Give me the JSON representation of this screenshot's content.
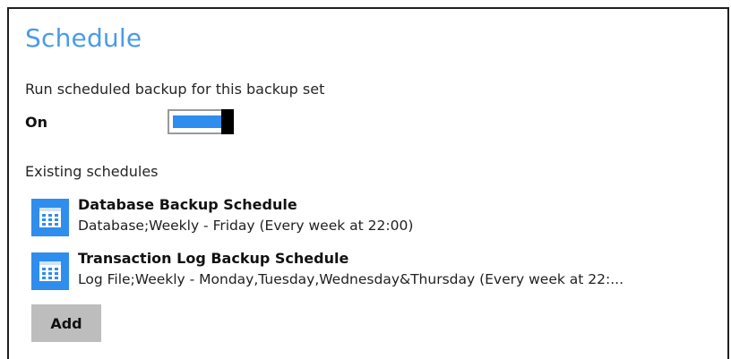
{
  "section": {
    "title": "Schedule"
  },
  "scheduled_backup": {
    "label": "Run scheduled backup for this backup set",
    "state_label": "On",
    "enabled": true
  },
  "existing": {
    "label": "Existing schedules",
    "schedules": [
      {
        "name": "Database Backup Schedule",
        "detail": "Database;Weekly - Friday (Every week at 22:00)",
        "icon": "calendar-icon"
      },
      {
        "name": "Transaction Log Backup Schedule",
        "detail": "Log File;Weekly - Monday,Tuesday,Wednesday&Thursday (Every week at 22:...",
        "icon": "calendar-icon"
      }
    ]
  },
  "actions": {
    "add_label": "Add"
  },
  "colors": {
    "accent": "#2f8ded",
    "title": "#4a9be8",
    "button_bg": "#bdbdbd"
  }
}
